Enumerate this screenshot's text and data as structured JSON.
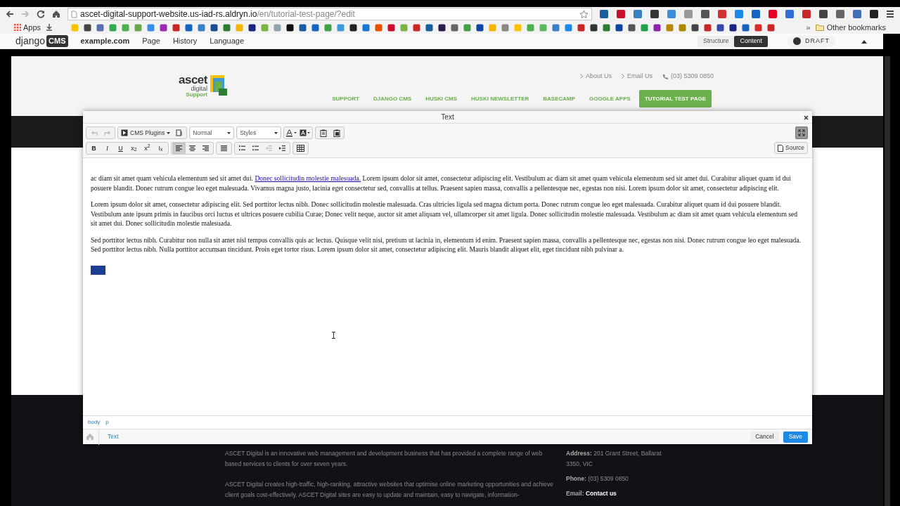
{
  "browser": {
    "address": {
      "host": "ascet-digital-support-website.us-iad-rs.aldryn.io",
      "path": "/en/tutorial-test-page/?edit"
    },
    "bookmarks": {
      "apps_label": "Apps",
      "overflow": "»",
      "other_label": "Other bookmarks"
    }
  },
  "cms_toolbar": {
    "logo_text": "django",
    "logo_badge": "CMS",
    "menu": [
      "example.com",
      "Page",
      "History",
      "Language"
    ],
    "modes": [
      {
        "label": "Structure",
        "selected": false
      },
      {
        "label": "Content",
        "selected": true
      }
    ],
    "draft_label": "DRAFT",
    "draft_on": true
  },
  "site_header": {
    "logo": {
      "name": "ascet",
      "sub": "digital",
      "tag": "Support"
    },
    "top_links": [
      {
        "kind": "link",
        "label": "About Us"
      },
      {
        "kind": "link",
        "label": "Email Us"
      },
      {
        "kind": "phone",
        "label": "(03) 5309 0850"
      }
    ],
    "nav": [
      {
        "label": "SUPPORT",
        "selected": false
      },
      {
        "label": "DJANGO CMS",
        "selected": false
      },
      {
        "label": "HUSKI CMS",
        "selected": false
      },
      {
        "label": "HUSKI NEWSLETTER",
        "selected": false
      },
      {
        "label": "BASECAMP",
        "selected": false
      },
      {
        "label": "GOOGLE APPS",
        "selected": false
      },
      {
        "label": "TUTORIAL TEST PAGE",
        "selected": true
      }
    ]
  },
  "editor": {
    "title": "Text",
    "dropdowns": [
      {
        "kind": "plugins",
        "label": "CMS Plugins"
      },
      {
        "kind": "format",
        "label": "Normal"
      },
      {
        "kind": "styles",
        "label": "Styles"
      }
    ],
    "format_buttons": [
      {
        "label": "B",
        "kind": "bold"
      },
      {
        "label": "I",
        "kind": "italic"
      },
      {
        "label": "U",
        "kind": "underline"
      },
      {
        "label": "x$_{2}$",
        "kind": "plain"
      },
      {
        "label": "x$^{2}$",
        "kind": "plain"
      },
      {
        "label": "I$_{x}$",
        "kind": "plain"
      }
    ],
    "align_buttons": [
      {
        "kind": "left",
        "selected": true
      },
      {
        "kind": "center",
        "selected": false
      },
      {
        "kind": "right",
        "selected": false
      }
    ],
    "source_label": "Source",
    "paragraphs": [
      [
        {
          "text": "ac diam sit amet quam vehicula elementum sed sit amet dui. ",
          "link": false
        },
        {
          "text": "Donec sollicitudin molestie malesuada.",
          "link": true
        },
        {
          "text": " Lorem ipsum dolor sit amet, consectetur adipiscing elit. Vestibulum ac diam sit amet quam vehicula elementum sed sit amet dui. Curabitur aliquet quam id dui posuere blandit. Donec rutrum congue leo eget malesuada. Vivamus magna justo, lacinia eget consectetur sed, convallis at tellus. Praesent sapien massa, convallis a pellentesque nec, egestas non nisi. Lorem ipsum dolor sit amet, consectetur adipiscing elit.",
          "link": false
        }
      ],
      [
        {
          "text": "Lorem ipsum dolor sit amet, consectetur adipiscing elit. Sed porttitor lectus nibh. Donec sollicitudin molestie malesuada. Cras ultricies ligula sed magna dictum porta. Donec rutrum congue leo eget malesuada. Curabitur aliquet quam id dui posuere blandit. Vestibulum ante ipsum primis in faucibus orci luctus et ultrices posuere cubilia Curae; Donec velit neque, auctor sit amet aliquam vel, ullamcorper sit amet ligula. Donec sollicitudin molestie malesuada. Vestibulum ac diam sit amet quam vehicula elementum sed sit amet dui. Donec sollicitudin molestie malesuada.",
          "link": false
        }
      ],
      [
        {
          "text": "Sed porttitor lectus nibh. Curabitur non nulla sit amet nisl tempus convallis quis ac lectus. Quisque velit nisi, pretium ut lacinia in, elementum id enim. Praesent sapien massa, convallis a pellentesque nec, egestas non nisi. Donec rutrum congue leo eget malesuada. Sed porttitor lectus nibh. Nulla porttitor accumsan tincidunt. Proin eget tortor risus. Lorem ipsum dolor sit amet, consectetur adipiscing elit. Mauris blandit aliquet elit, eget tincidunt nibh pulvinar a.",
          "link": false
        }
      ]
    ],
    "element_path": [
      "body",
      "p"
    ],
    "breadcrumb": "Text",
    "cancel_label": "Cancel",
    "save_label": "Save"
  },
  "footer": {
    "about": [
      "ASCET Digital is an innovative web management and development business that has provided a complete range of web based services to clients for over seven years.",
      "ASCET Digital creates high-traffic, high-ranking, attractive websites that optimise online marketing opportunities and achieve client goals cost-effectively. ASCET Digital sites are easy to update and maintain, easy to navigate, information-"
    ],
    "contact": [
      {
        "label": "Address:",
        "value": "201 Grant Street, Ballarat 3350, VIC",
        "link": false
      },
      {
        "label": "Phone:",
        "value": "(03) 5309 0850",
        "link": false
      },
      {
        "label": "Email:",
        "value": "Contact us",
        "link": true
      }
    ]
  }
}
